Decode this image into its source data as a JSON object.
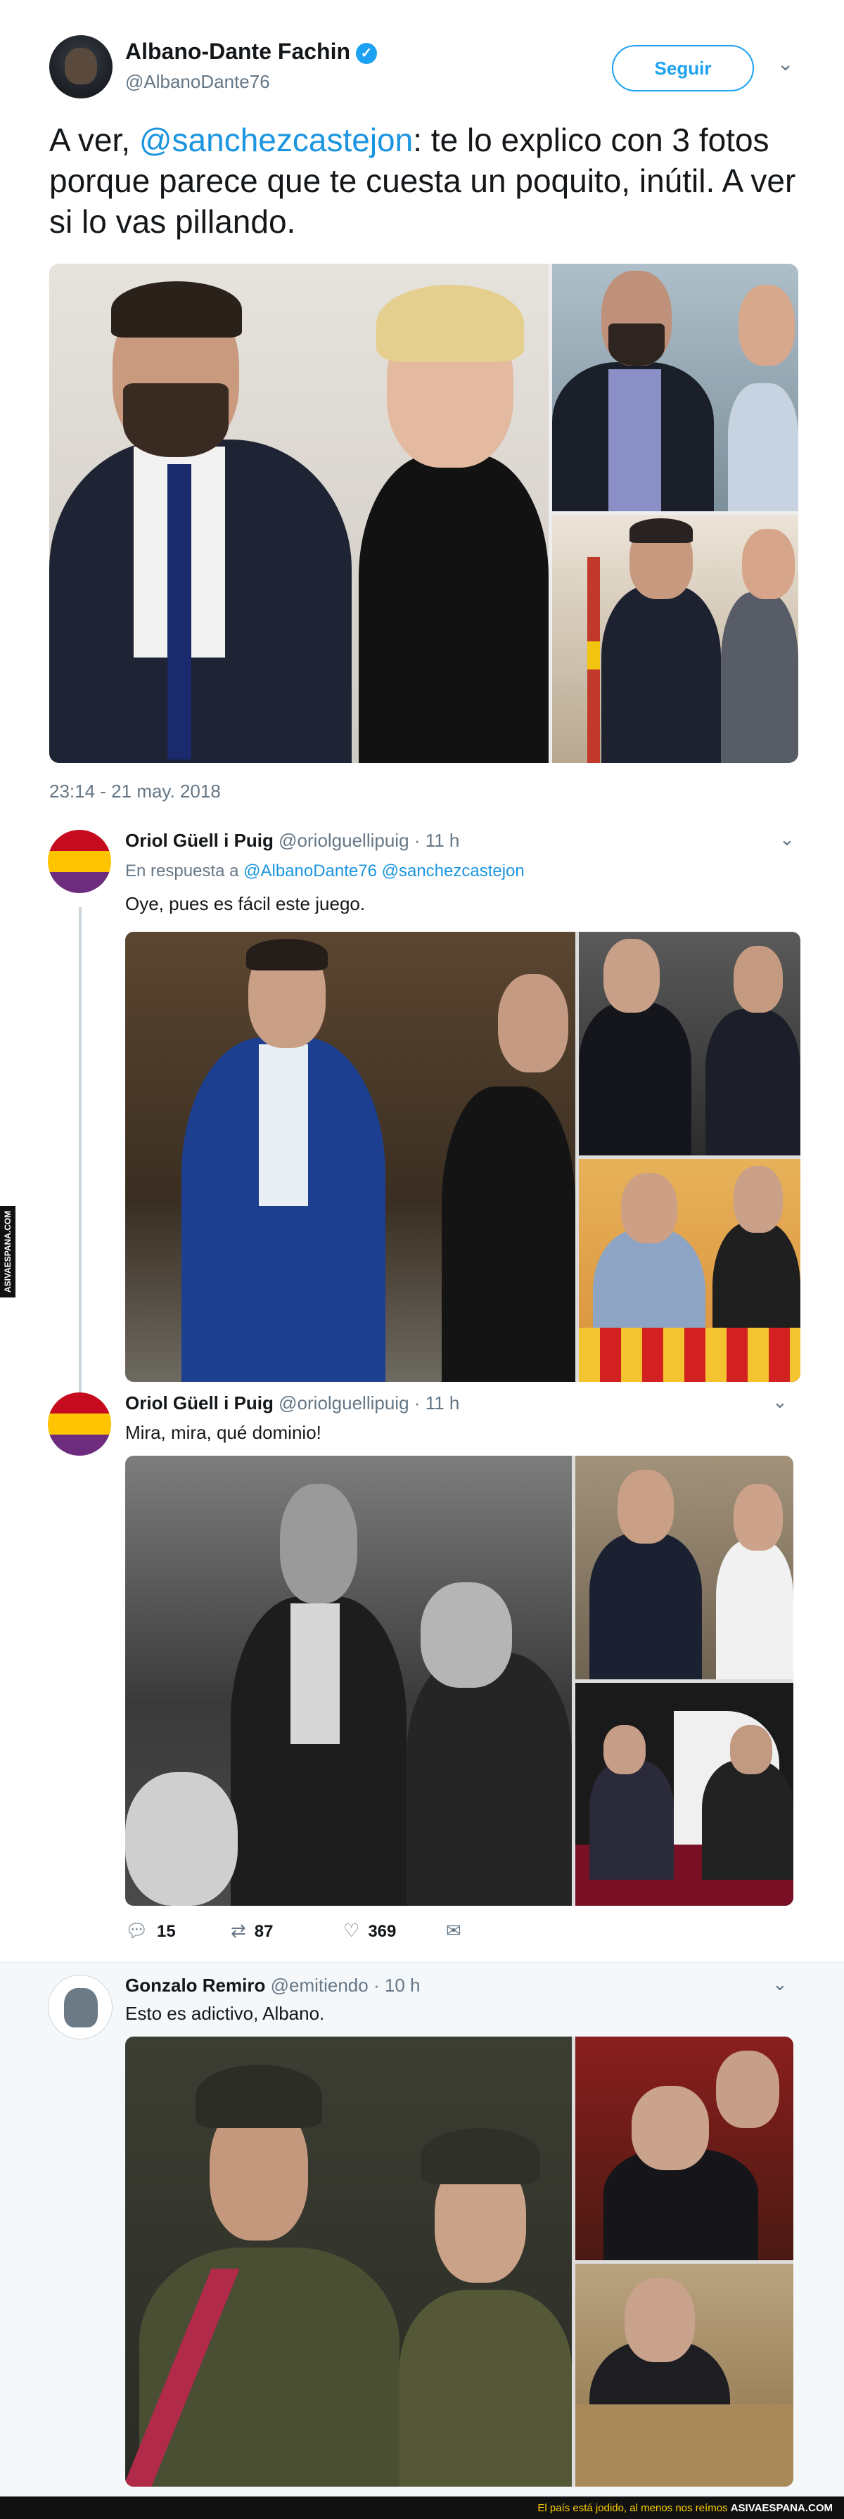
{
  "main_tweet": {
    "author_name": "Albano-Dante Fachin",
    "handle": "@AlbanoDante76",
    "follow_label": "Seguir",
    "text_prefix": "A ver, ",
    "mention": "@sanchezcastejon",
    "text_suffix": ": te lo explico con 3 fotos porque parece que te cuesta un poquito, inútil. A ver si lo vas pillando.",
    "timestamp": "23:14 - 21 may. 2018"
  },
  "replies": [
    {
      "author_name": "Oriol Güell i Puig",
      "handle": "@oriolguellipuig",
      "time": "11 h",
      "context_prefix": "En respuesta a",
      "context_mentions": "@AlbanoDante76 @sanchezcastejon",
      "text": "Oye, pues es fácil este juego."
    },
    {
      "author_name": "Oriol Güell i Puig",
      "handle": "@oriolguellipuig",
      "time": "11 h",
      "text": "Mira, mira, qué dominio!",
      "actions": {
        "replies": "15",
        "retweets": "87",
        "likes": "369"
      }
    },
    {
      "author_name": "Gonzalo Remiro",
      "handle": "@emitiendo",
      "time": "10 h",
      "text": "Esto es adictivo, Albano."
    }
  ],
  "separator": "·",
  "watermark": {
    "side": "ASIVAESPANA.COM",
    "footer_text": "El país está jodido, al menos nos reímos",
    "footer_brand": "ASIVAESPANA.COM"
  },
  "icons": {
    "verified": "verified-badge-icon",
    "chevron": "chevron-down-icon",
    "reply": "reply-icon",
    "retweet": "retweet-icon",
    "like": "heart-icon",
    "message": "direct-message-icon"
  },
  "colors": {
    "accent": "#1da1f2",
    "text": "#14171a",
    "secondary": "#657786",
    "flag_red": "#c60b1e",
    "flag_yellow": "#ffc400",
    "flag_purple": "#6d2c7e"
  }
}
